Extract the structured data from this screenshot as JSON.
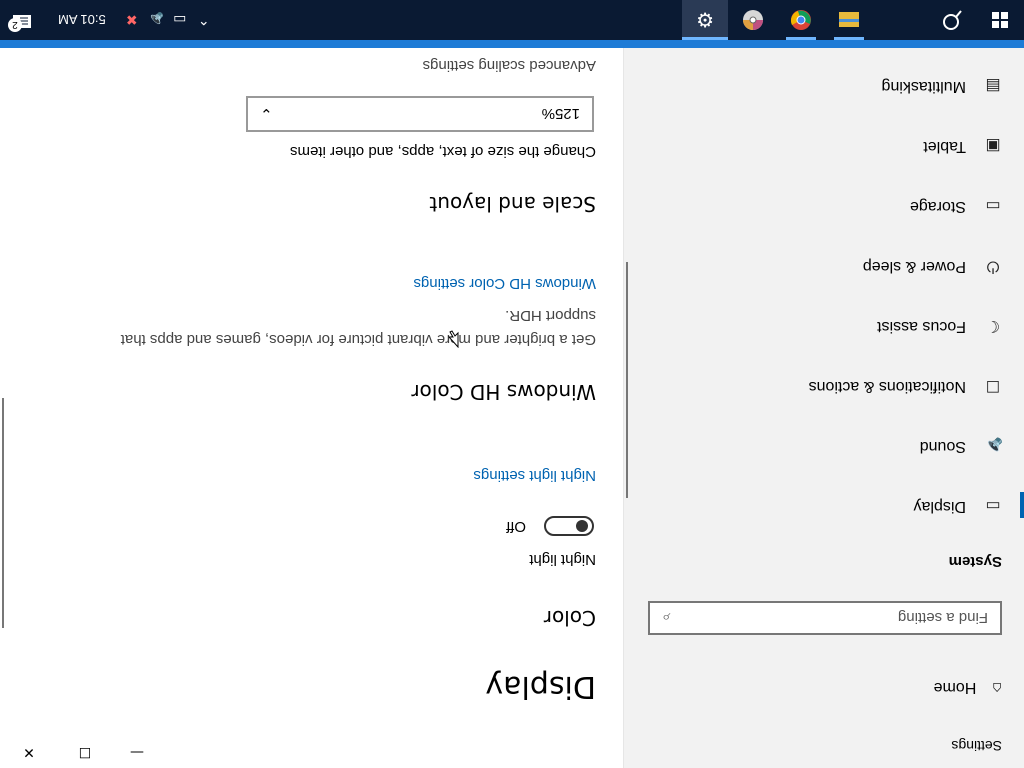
{
  "window": {
    "title": "Settings",
    "minimize_glyph": "—",
    "maximize_glyph": "☐",
    "close_glyph": "✕"
  },
  "nav": {
    "home": "Home",
    "search_placeholder": "Find a setting",
    "section": "System",
    "items": [
      {
        "label": "Display",
        "icon": "display-icon",
        "glyph": "▭"
      },
      {
        "label": "Sound",
        "icon": "sound-icon",
        "glyph": "🔈"
      },
      {
        "label": "Notifications & actions",
        "icon": "notifications-icon",
        "glyph": "☐"
      },
      {
        "label": "Focus assist",
        "icon": "moon-icon",
        "glyph": "☾"
      },
      {
        "label": "Power & sleep",
        "icon": "power-icon",
        "glyph": "⏻"
      },
      {
        "label": "Storage",
        "icon": "storage-icon",
        "glyph": "▭"
      },
      {
        "label": "Tablet",
        "icon": "tablet-icon",
        "glyph": "▣"
      },
      {
        "label": "Multitasking",
        "icon": "multitasking-icon",
        "glyph": "▤"
      }
    ]
  },
  "main": {
    "page_title": "Display",
    "color_heading": "Color",
    "night_light_label": "Night light",
    "night_light_state": "Off",
    "night_light_link": "Night light settings",
    "hd_heading": "Windows HD Color",
    "hd_desc_line1": "Get a brighter and more vibrant picture for videos, games and apps that",
    "hd_desc_line2": "support HDR.",
    "hd_link": "Windows HD Color settings",
    "scale_heading": "Scale and layout",
    "scale_desc": "Change the size of text, apps, and other items",
    "scale_value": "125%",
    "advanced_link": "Advanced scaling settings"
  },
  "taskbar": {
    "time": "5:01 AM",
    "notification_count": "2",
    "apps": [
      {
        "name": "settings-app-icon"
      },
      {
        "name": "media-app-icon"
      },
      {
        "name": "chrome-app-icon"
      },
      {
        "name": "file-explorer-app-icon"
      }
    ]
  },
  "colors": {
    "accent": "#0063b1",
    "taskbar": "#0a1a33",
    "taskbar_accent": "#1e7bd6",
    "nav_bg": "#f2f2f2"
  }
}
